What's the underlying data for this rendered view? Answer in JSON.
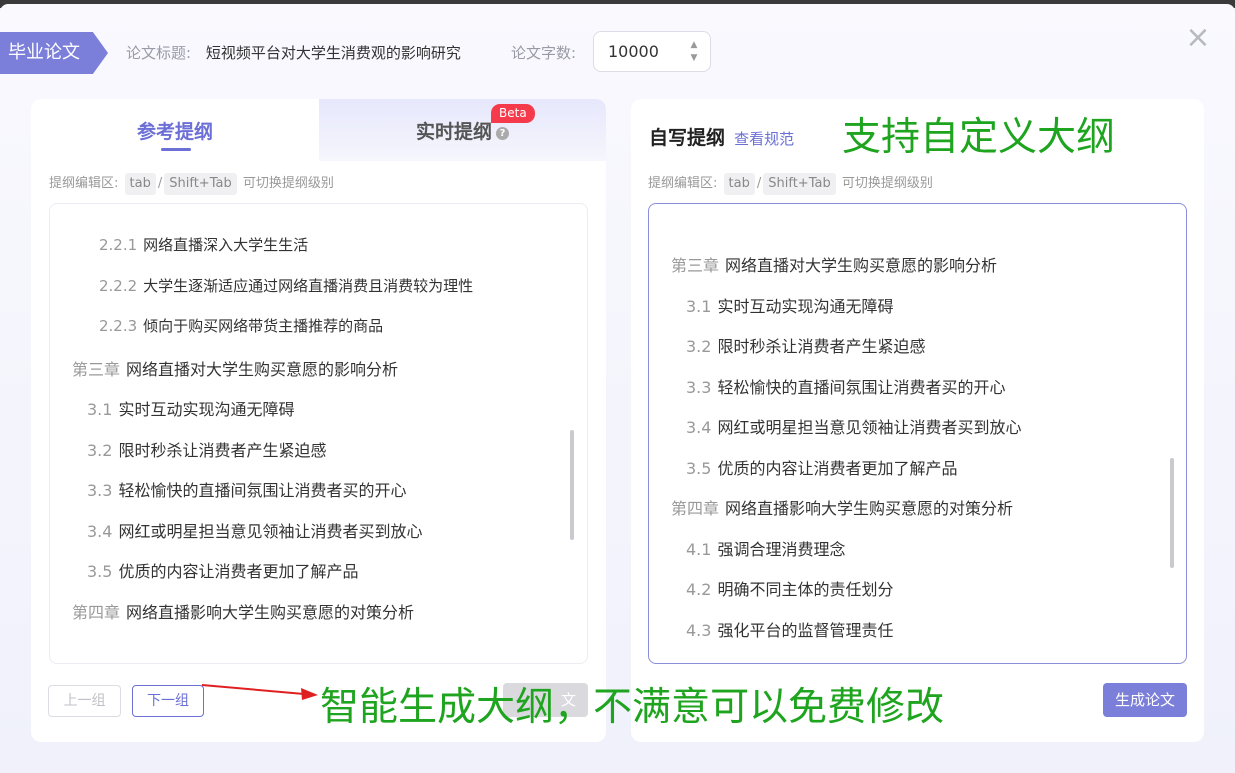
{
  "header": {
    "badge": "毕业论文",
    "title_label": "论文标题:",
    "title_value": "短视频平台对大学生消费观的影响研究",
    "words_label": "论文字数:",
    "words_value": "10000"
  },
  "left_panel": {
    "tab_reference": "参考提纲",
    "tab_realtime": "实时提纲",
    "beta": "Beta",
    "hint_prefix": "提纲编辑区:",
    "hint_key1": "tab",
    "hint_sep": "/",
    "hint_key2": "Shift+Tab",
    "hint_suffix": "可切换提纲级别",
    "outline": [
      {
        "num": "2.2.1",
        "text": "网络直播深入大学生生活"
      },
      {
        "num": "2.2.2",
        "text": "大学生逐渐适应通过网络直播消费且消费较为理性"
      },
      {
        "num": "2.2.3",
        "text": "倾向于购买网络带货主播推荐的商品"
      },
      {
        "num": "第三章",
        "text": "网络直播对大学生购买意愿的影响分析"
      },
      {
        "num": "3.1",
        "text": "实时互动实现沟通无障碍"
      },
      {
        "num": "3.2",
        "text": "限时秒杀让消费者产生紧迫感"
      },
      {
        "num": "3.3",
        "text": "轻松愉快的直播间氛围让消费者买的开心"
      },
      {
        "num": "3.4",
        "text": "网红或明星担当意见领袖让消费者买到放心"
      },
      {
        "num": "3.5",
        "text": "优质的内容让消费者更加了解产品"
      },
      {
        "num": "第四章",
        "text": "网络直播影响大学生购买意愿的对策分析"
      }
    ],
    "prev_button": "上一组",
    "next_button": "下一组",
    "generate_button": "文"
  },
  "right_panel": {
    "title": "自写提纲",
    "view_rules": "查看规范",
    "hint_prefix": "提纲编辑区:",
    "hint_key1": "tab",
    "hint_sep": "/",
    "hint_key2": "Shift+Tab",
    "hint_suffix": "可切换提纲级别",
    "outline": [
      {
        "num": "第三章",
        "text": "网络直播对大学生购买意愿的影响分析"
      },
      {
        "num": "3.1",
        "text": "实时互动实现沟通无障碍"
      },
      {
        "num": "3.2",
        "text": "限时秒杀让消费者产生紧迫感"
      },
      {
        "num": "3.3",
        "text": "轻松愉快的直播间氛围让消费者买的开心"
      },
      {
        "num": "3.4",
        "text": "网红或明星担当意见领袖让消费者买到放心"
      },
      {
        "num": "3.5",
        "text": "优质的内容让消费者更加了解产品"
      },
      {
        "num": "第四章",
        "text": "网络直播影响大学生购买意愿的对策分析"
      },
      {
        "num": "4.1",
        "text": "强调合理消费理念"
      },
      {
        "num": "4.2",
        "text": "明确不同主体的责任划分"
      },
      {
        "num": "4.3",
        "text": "强化平台的监督管理责任"
      }
    ],
    "generate_button": "生成论文"
  },
  "annotations": {
    "custom_outline": "支持自定义大纲",
    "smart_generate": "智能生成大纲，不满意可以免费修改"
  },
  "colors": {
    "accent": "#7b7fd9",
    "annotation_green": "#1ea41e",
    "arrow_red": "#e02020",
    "beta_red": "#f53b4b"
  }
}
